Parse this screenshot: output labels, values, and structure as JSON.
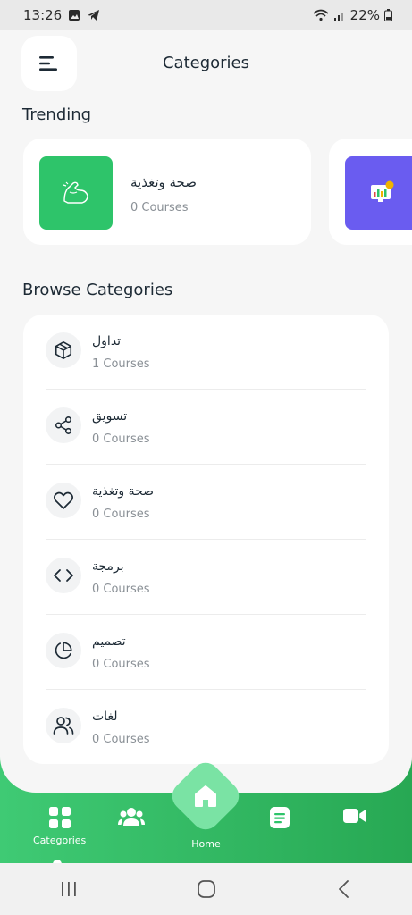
{
  "status_bar": {
    "time": "13:26",
    "battery": "22%"
  },
  "header": {
    "title": "Categories"
  },
  "trending": {
    "title": "Trending",
    "items": [
      {
        "name": "صحة وتغذية",
        "count": "0 Courses",
        "color": "#2ec46a"
      },
      {
        "name": "",
        "count": "",
        "color": "#6a5cf0"
      }
    ]
  },
  "browse": {
    "title": "Browse Categories",
    "items": [
      {
        "name": "تداول",
        "count": "1 Courses",
        "icon": "box-icon"
      },
      {
        "name": "تسويق",
        "count": "0 Courses",
        "icon": "share-icon"
      },
      {
        "name": "صحة وتغذية",
        "count": "0 Courses",
        "icon": "heart-icon"
      },
      {
        "name": "برمجة",
        "count": "0 Courses",
        "icon": "code-icon"
      },
      {
        "name": "تصميم",
        "count": "0 Courses",
        "icon": "pie-chart-icon"
      },
      {
        "name": "لغات",
        "count": "0 Courses",
        "icon": "users-icon"
      }
    ]
  },
  "bottom_nav": {
    "categories_label": "Categories",
    "home_label": "Home"
  },
  "colors": {
    "accent": "#2ec46a",
    "accent_dark": "#27a853",
    "home_diamond": "#7ae3a4"
  }
}
